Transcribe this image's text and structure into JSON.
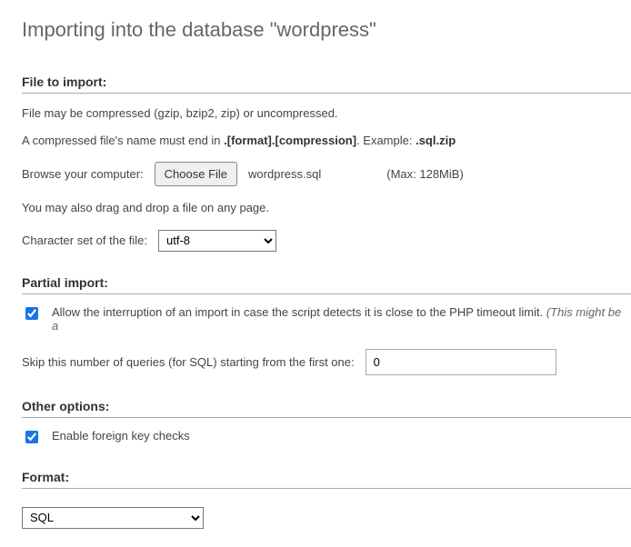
{
  "page_title": "Importing into the database \"wordpress\"",
  "file_import": {
    "heading": "File to import:",
    "hint1": "File may be compressed (gzip, bzip2, zip) or uncompressed.",
    "hint2a": "A compressed file's name must end in ",
    "hint2b_bold": ".[format].[compression]",
    "hint2c": ". Example: ",
    "hint2d_bold": ".sql.zip",
    "browse_label": "Browse your computer:",
    "choose_button": "Choose File",
    "selected_file": "wordpress.sql",
    "max_size": "(Max: 128MiB)",
    "drag_hint": "You may also drag and drop a file on any page.",
    "charset_label": "Character set of the file:",
    "charset_value": "utf-8"
  },
  "partial": {
    "heading": "Partial import:",
    "allow_checked": true,
    "allow_text": "Allow the interruption of an import in case the script detects it is close to the PHP timeout limit. ",
    "allow_hint_italic": "(This might be a",
    "skip_label": "Skip this number of queries (for SQL) starting from the first one:",
    "skip_value": "0"
  },
  "other": {
    "heading": "Other options:",
    "fk_checked": true,
    "fk_label": "Enable foreign key checks"
  },
  "format": {
    "heading": "Format:",
    "value": "SQL"
  }
}
